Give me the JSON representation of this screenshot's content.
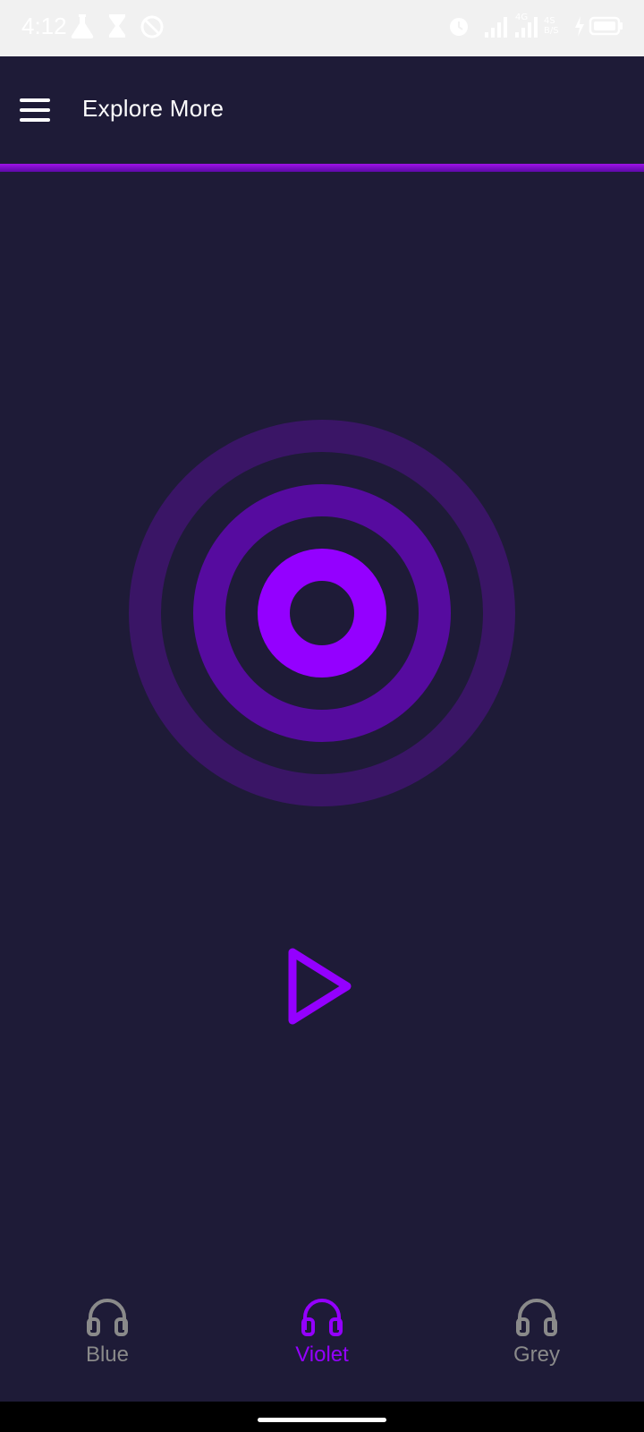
{
  "status_bar": {
    "time": "4:12",
    "network_label": "4G",
    "speed_label": "4S\nB/S",
    "icons": [
      "flask-icon",
      "hourglass-icon",
      "no-disturb-icon",
      "alarm-icon",
      "signal-icon",
      "signal-icon",
      "charging-icon",
      "battery-icon"
    ]
  },
  "app_bar": {
    "title": "Explore More"
  },
  "colors": {
    "background": "#1e1b37",
    "accent": "#9400ff",
    "ring_mid": "#560b9f",
    "ring_outer": "#3a1566",
    "inactive": "#8a8a8a"
  },
  "player": {
    "play_icon": "play-icon"
  },
  "bottom_nav": {
    "items": [
      {
        "label": "Blue",
        "icon": "headphones-icon",
        "active": false
      },
      {
        "label": "Violet",
        "icon": "headphones-icon",
        "active": true
      },
      {
        "label": "Grey",
        "icon": "headphones-icon",
        "active": false
      }
    ]
  }
}
